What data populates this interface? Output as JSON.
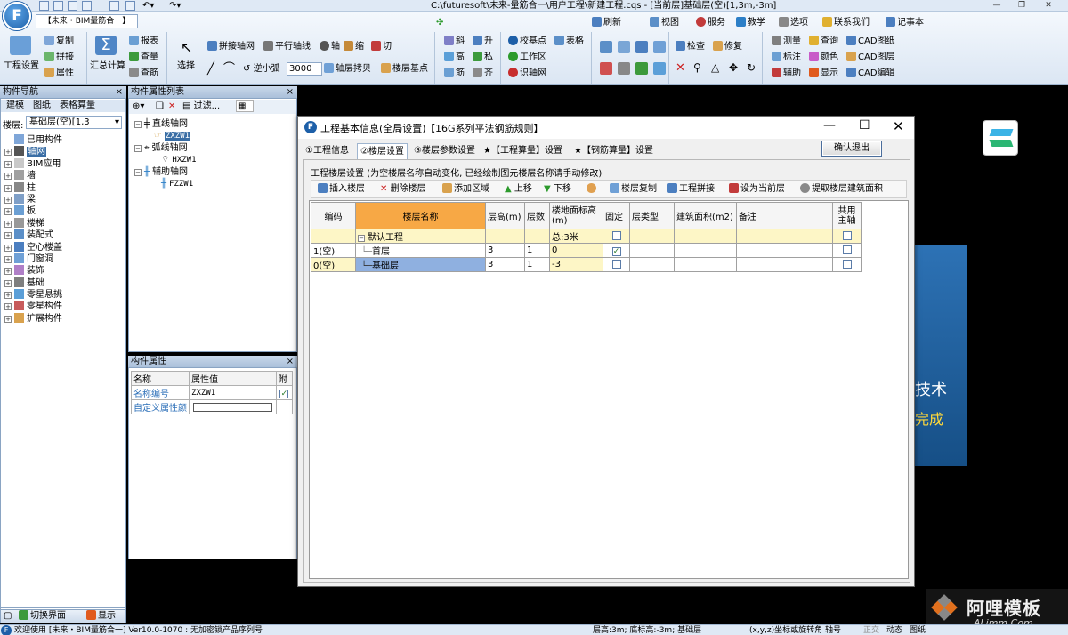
{
  "window": {
    "title": "C:\\futuresoft\\未来-量筋合一\\用户工程\\新建工程.cqs - [当前层]基础层(空)[1,3m,-3m]",
    "app_tab": "【未来・BIM量筋合一】",
    "app_logo": "F"
  },
  "ribbon": {
    "g1": {
      "big": "工程设置",
      "items": [
        "复制",
        "拼接",
        "属性"
      ]
    },
    "g2": {
      "big": "汇总计算",
      "items": [
        "报表",
        "查量",
        "查筋"
      ]
    },
    "g3": {
      "big": "选择",
      "row1": [
        "拼接轴网",
        "平行轴线",
        "轴",
        "缩",
        "切"
      ],
      "row2_value": "3000",
      "row2_label": "逆小弧",
      "row3": [
        "轴层拷贝",
        "楼层基点"
      ]
    },
    "g4": {
      "items": [
        "斜",
        "升",
        "高",
        "私",
        "筋",
        "齐"
      ]
    },
    "g5": {
      "items": [
        "校基点",
        "表格",
        "工作区",
        "识轴网"
      ]
    },
    "g7": {
      "items": [
        "检查",
        "修复"
      ]
    },
    "g8": {
      "items": [
        "测量",
        "查询",
        "CAD图纸",
        "标注",
        "颜色",
        "CAD图层",
        "辅助",
        "显示",
        "CAD编辑"
      ]
    },
    "top": [
      "刷新",
      "视图",
      "服务",
      "教学",
      "选项",
      "联系我们",
      "记事本"
    ]
  },
  "left_panel": {
    "title": "构件导航",
    "tabs": [
      "建模",
      "图纸",
      "表格算量"
    ],
    "floor_label": "楼层:",
    "floor_value": "基础层(空)[1,3",
    "tree": [
      "已用构件",
      "轴网",
      "BIM应用",
      "墙",
      "柱",
      "梁",
      "板",
      "楼梯",
      "装配式",
      "空心楼盖",
      "门窗洞",
      "装饰",
      "基础",
      "零星悬挑",
      "零星构件",
      "扩展构件"
    ],
    "bottom": [
      "切换界面",
      "显示"
    ]
  },
  "list_panel": {
    "title": "构件属性列表",
    "filter": "过滤...",
    "tree": [
      {
        "label": "直线轴网",
        "child": "ZXZW1"
      },
      {
        "label": "弧线轴网",
        "child": "HXZW1"
      },
      {
        "label": "辅助轴网",
        "child": "FZZW1"
      }
    ]
  },
  "prop_panel": {
    "title": "构件属性",
    "headers": [
      "名称",
      "属性值",
      "附"
    ],
    "rows": [
      {
        "name": "名称编号",
        "value": "ZXZW1",
        "checked": true
      },
      {
        "name": "自定义属性颜",
        "value": "",
        "checked": false
      }
    ]
  },
  "dialog": {
    "title": "工程基本信息(全局设置)",
    "rule": "【16G系列平法钢筋规则】",
    "tabs": [
      "①工程信息",
      "②楼层设置",
      "③楼层参数设置",
      "★【工程算量】设置",
      "★【钢筋算量】设置"
    ],
    "confirm": "确认退出",
    "section": "工程楼层设置 (为空楼层名称自动变化, 已经绘制图元楼层名称请手动修改)",
    "toolbar": [
      "插入楼层",
      "删除楼层",
      "添加区域",
      "上移",
      "下移",
      "楼层复制",
      "工程拼接",
      "设为当前层",
      "提取楼层建筑面积"
    ],
    "columns": [
      "编码",
      "楼层名称",
      "层高(m)",
      "层数",
      "楼地面标高(m)",
      "固定",
      "层类型",
      "建筑面积(m2)",
      "备注",
      "共用主轴"
    ],
    "rows": [
      {
        "code": "",
        "name": "默认工程",
        "height": "",
        "count": "",
        "elev": "总:3米",
        "fixed": false,
        "type": "",
        "area": "",
        "note": "",
        "shared": false
      },
      {
        "code": "1(空)",
        "name": "首层",
        "height": "3",
        "count": "1",
        "elev": "0",
        "fixed": true,
        "type": "",
        "area": "",
        "note": "",
        "shared": false
      },
      {
        "code": "0(空)",
        "name": "基础层",
        "height": "3",
        "count": "1",
        "elev": "-3",
        "fixed": false,
        "type": "",
        "area": "",
        "note": "",
        "shared": false
      }
    ]
  },
  "canvas_text": {
    "line1": "技术",
    "line2": "完成"
  },
  "watermark": {
    "cn": "阿哩模板",
    "en": "ALimm.Com"
  },
  "status": {
    "left": "欢迎使用 [未来・BIM量筋合一] Ver10.0-1070 : 无加密锁产品序列号",
    "mid": "层高:3m; 底标高:-3m; 基础层",
    "right": "(x,y,z)坐标或旋转角 轴号",
    "mode": [
      "正交",
      "动态",
      "图纸"
    ]
  },
  "colors": {
    "accent": "#1d5fa8",
    "header_orange": "#f7a845",
    "select_blue": "#8fb0e0",
    "elev_yellow": "#fdf6c6",
    "canvas_blue": "#1e5b95"
  }
}
